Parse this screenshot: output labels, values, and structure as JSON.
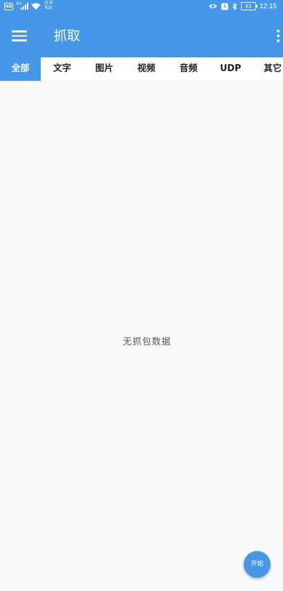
{
  "status_bar": {
    "hd_badge": "HD",
    "network_type": "4G",
    "speed_value": "0.9",
    "speed_unit": "K/s",
    "battery_level": "82",
    "time": "12:15",
    "left_icons": [
      "hd-icon",
      "signal-icon",
      "wifi-icon"
    ],
    "right_icons": [
      "eye-icon",
      "alarm-icon",
      "bluetooth-icon",
      "battery-icon"
    ]
  },
  "app_bar": {
    "title": "抓取",
    "menu_icon": "hamburger-menu-icon",
    "overflow_icon": "more-vert-icon",
    "background_color": "#4697e8"
  },
  "tabs": [
    {
      "label": "全部",
      "active": true
    },
    {
      "label": "文字",
      "active": false
    },
    {
      "label": "图片",
      "active": false
    },
    {
      "label": "视频",
      "active": false
    },
    {
      "label": "音频",
      "active": false
    },
    {
      "label": "UDP",
      "active": false
    },
    {
      "label": "其它",
      "active": false
    }
  ],
  "content": {
    "empty_message": "无抓包数据"
  },
  "fab": {
    "label": "开始"
  }
}
